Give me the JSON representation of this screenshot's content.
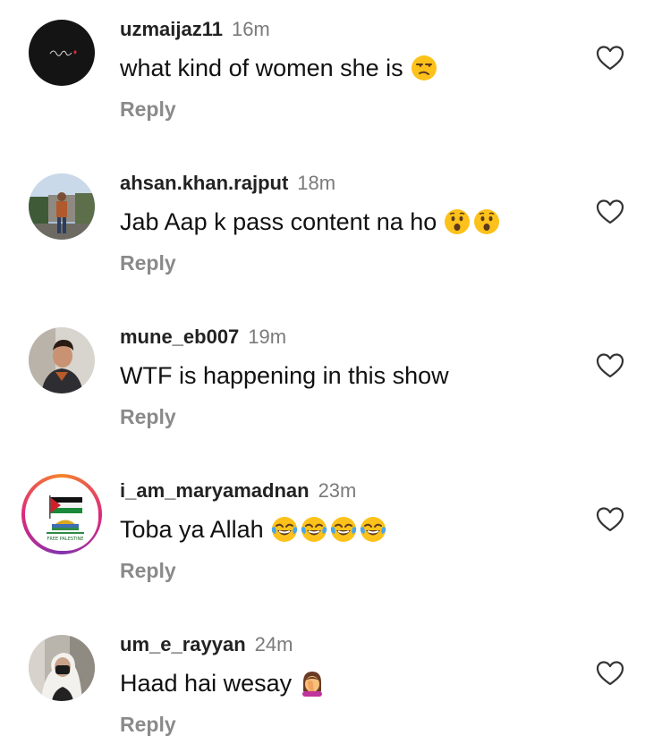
{
  "comments": [
    {
      "username": "uzmaijaz11",
      "time": "16m",
      "text": "what kind of women she is",
      "emojis": [
        "unamused-face"
      ],
      "reply_label": "Reply",
      "avatar": "dark-signature-avatar"
    },
    {
      "username": "ahsan.khan.rajput",
      "time": "18m",
      "text": "Jab Aap k pass content na ho",
      "emojis": [
        "hushed-face",
        "hushed-face"
      ],
      "reply_label": "Reply",
      "avatar": "man-outdoors-avatar"
    },
    {
      "username": "mune_eb007",
      "time": "19m",
      "text": "WTF is happening in this show",
      "emojis": [],
      "reply_label": "Reply",
      "avatar": "man-portrait-avatar"
    },
    {
      "username": "i_am_maryamadnan",
      "time": "23m",
      "text": "Toba ya Allah",
      "emojis": [
        "tears-of-joy-face",
        "tears-of-joy-face",
        "tears-of-joy-face",
        "tears-of-joy-face"
      ],
      "reply_label": "Reply",
      "avatar": "palestine-flag-avatar",
      "has_story_ring": true,
      "avatar_caption": "FREE PALESTINE"
    },
    {
      "username": "um_e_rayyan",
      "time": "24m",
      "text": "Haad hai wesay",
      "emojis": [
        "woman-facepalming"
      ],
      "reply_label": "Reply",
      "avatar": "woman-in-car-avatar"
    }
  ],
  "colors": {
    "username": "#222222",
    "timestamp": "#7a7a7a",
    "reply": "#8a8a8a",
    "text": "#111111",
    "emoji_yellow": "#fcc21b",
    "story_ring": "#dd2a7b"
  },
  "icons": {
    "like": "heart-outline-icon"
  }
}
